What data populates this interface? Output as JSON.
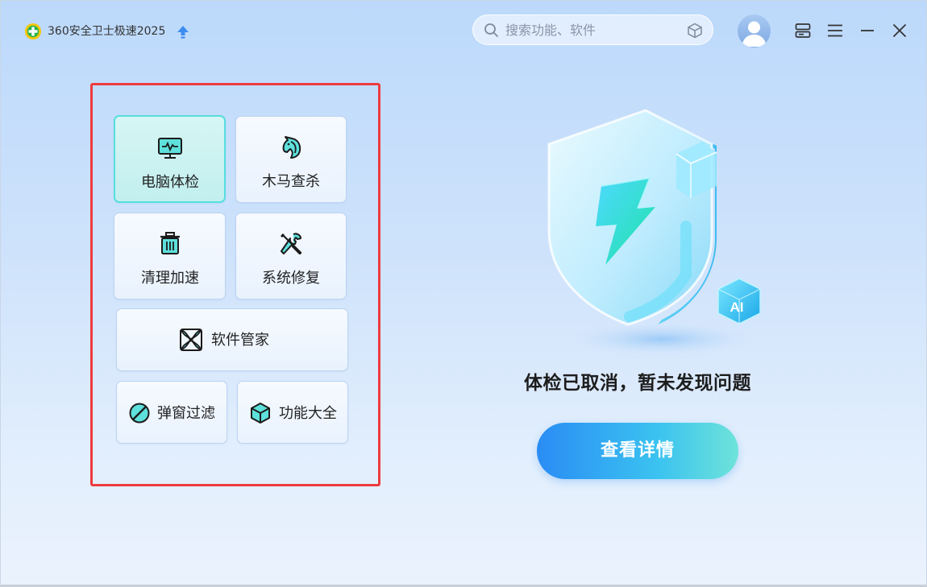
{
  "app": {
    "title": "360安全卫士极速2025"
  },
  "search": {
    "placeholder": "搜索功能、软件"
  },
  "icons": {
    "logo": "360-logo-icon",
    "update": "arrow-up-icon",
    "search": "search-icon",
    "cube": "cube-icon",
    "avatar": "user-avatar-icon",
    "skin": "skin-icon",
    "menu": "menu-icon",
    "minimize": "minimize-icon",
    "close": "close-icon"
  },
  "tools": {
    "checkup": {
      "label": "电脑体检",
      "icon": "monitor-pulse-icon"
    },
    "trojan": {
      "label": "木马查杀",
      "icon": "horse-icon"
    },
    "clean": {
      "label": "清理加速",
      "icon": "trash-icon"
    },
    "repair": {
      "label": "系统修复",
      "icon": "wrench-screwdriver-icon"
    },
    "software": {
      "label": "软件管家",
      "icon": "software-manager-icon"
    },
    "popup": {
      "label": "弹窗过滤",
      "icon": "popup-block-icon"
    },
    "features": {
      "label": "功能大全",
      "icon": "cube-icon"
    }
  },
  "hero": {
    "ai_badge": "AI"
  },
  "status": {
    "text": "体检已取消，暂未发现问题"
  },
  "actions": {
    "detail_label": "查看详情"
  },
  "colors": {
    "accent": "#2a8cf4",
    "accent_end": "#6ee3d9",
    "highlight_frame": "#ee3b3f",
    "active_tile": "#56dede"
  }
}
